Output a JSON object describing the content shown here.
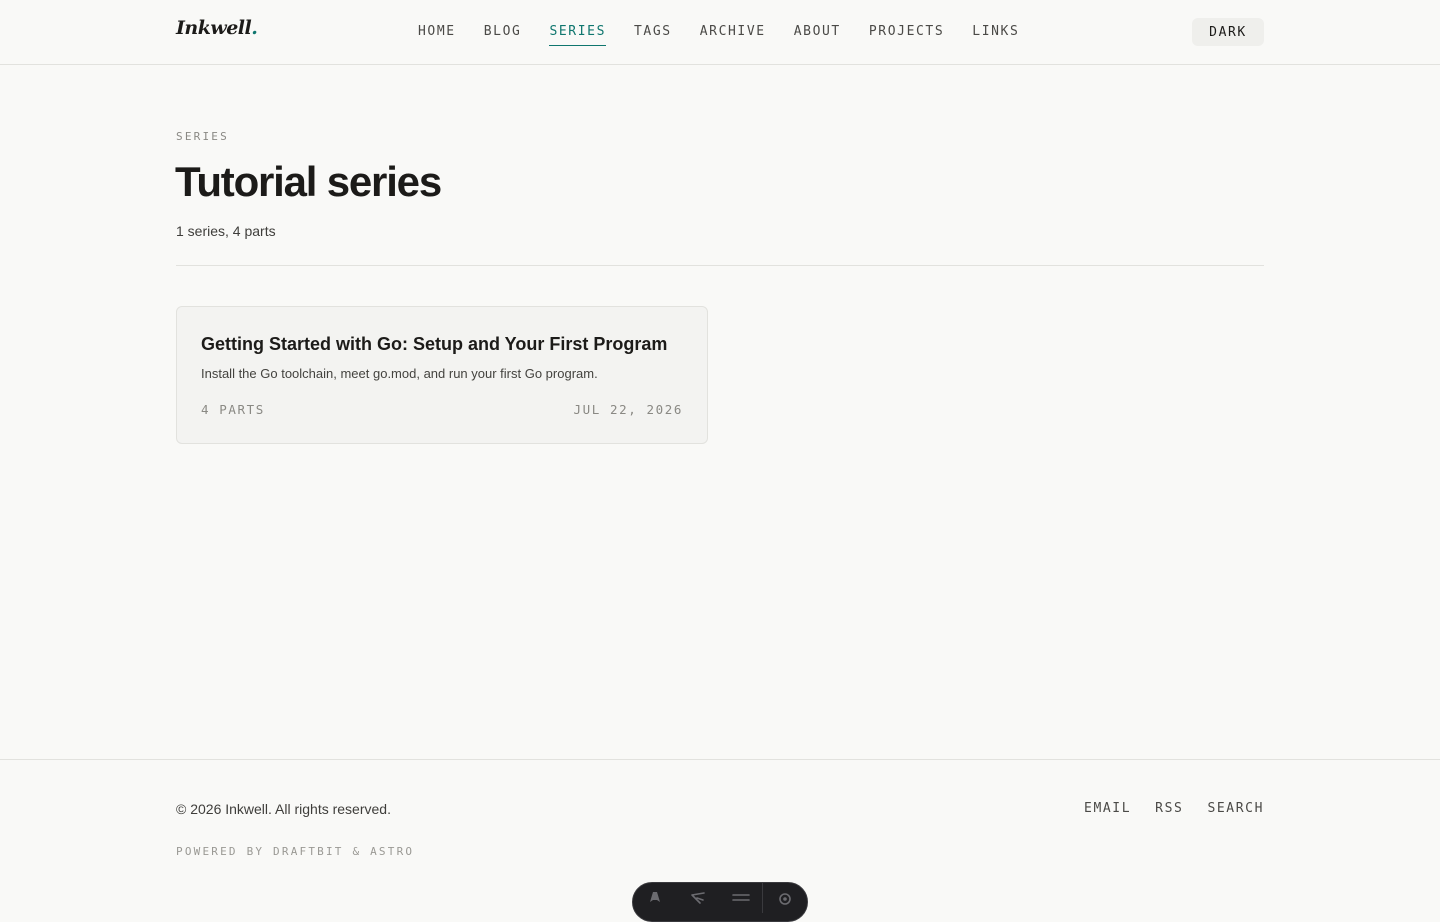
{
  "header": {
    "logo": "Inkwell",
    "logo_dot": ".",
    "nav": [
      {
        "label": "HOME",
        "active": false
      },
      {
        "label": "BLOG",
        "active": false
      },
      {
        "label": "SERIES",
        "active": true
      },
      {
        "label": "TAGS",
        "active": false
      },
      {
        "label": "ARCHIVE",
        "active": false
      },
      {
        "label": "ABOUT",
        "active": false
      },
      {
        "label": "PROJECTS",
        "active": false
      },
      {
        "label": "LINKS",
        "active": false
      }
    ],
    "theme_toggle_label": "DARK"
  },
  "main": {
    "eyebrow": "SERIES",
    "title": "Tutorial series",
    "summary": "1 series, 4 parts",
    "series": [
      {
        "title": "Getting Started with Go: Setup and Your First Program",
        "description": "Install the Go toolchain, meet go.mod, and run your first Go program.",
        "parts": "4 PARTS",
        "date": "JUL 22, 2026"
      }
    ]
  },
  "footer": {
    "copyright": "© 2026 Inkwell. All rights reserved.",
    "links": [
      "EMAIL",
      "RSS",
      "SEARCH"
    ],
    "powered_by": "POWERED BY DRAFTBIT & ASTRO"
  },
  "colors": {
    "accent": "#0f766e",
    "background": "#f9f9f7",
    "text": "#1c1b19",
    "muted": "#8a8984",
    "border": "#e2e2de",
    "toolbar": "#1f1f22"
  },
  "icons": {
    "dev_toolbar": [
      "astro-logo-icon",
      "cursor-inspect-icon",
      "menu-icon",
      "settings-gear-icon"
    ]
  }
}
